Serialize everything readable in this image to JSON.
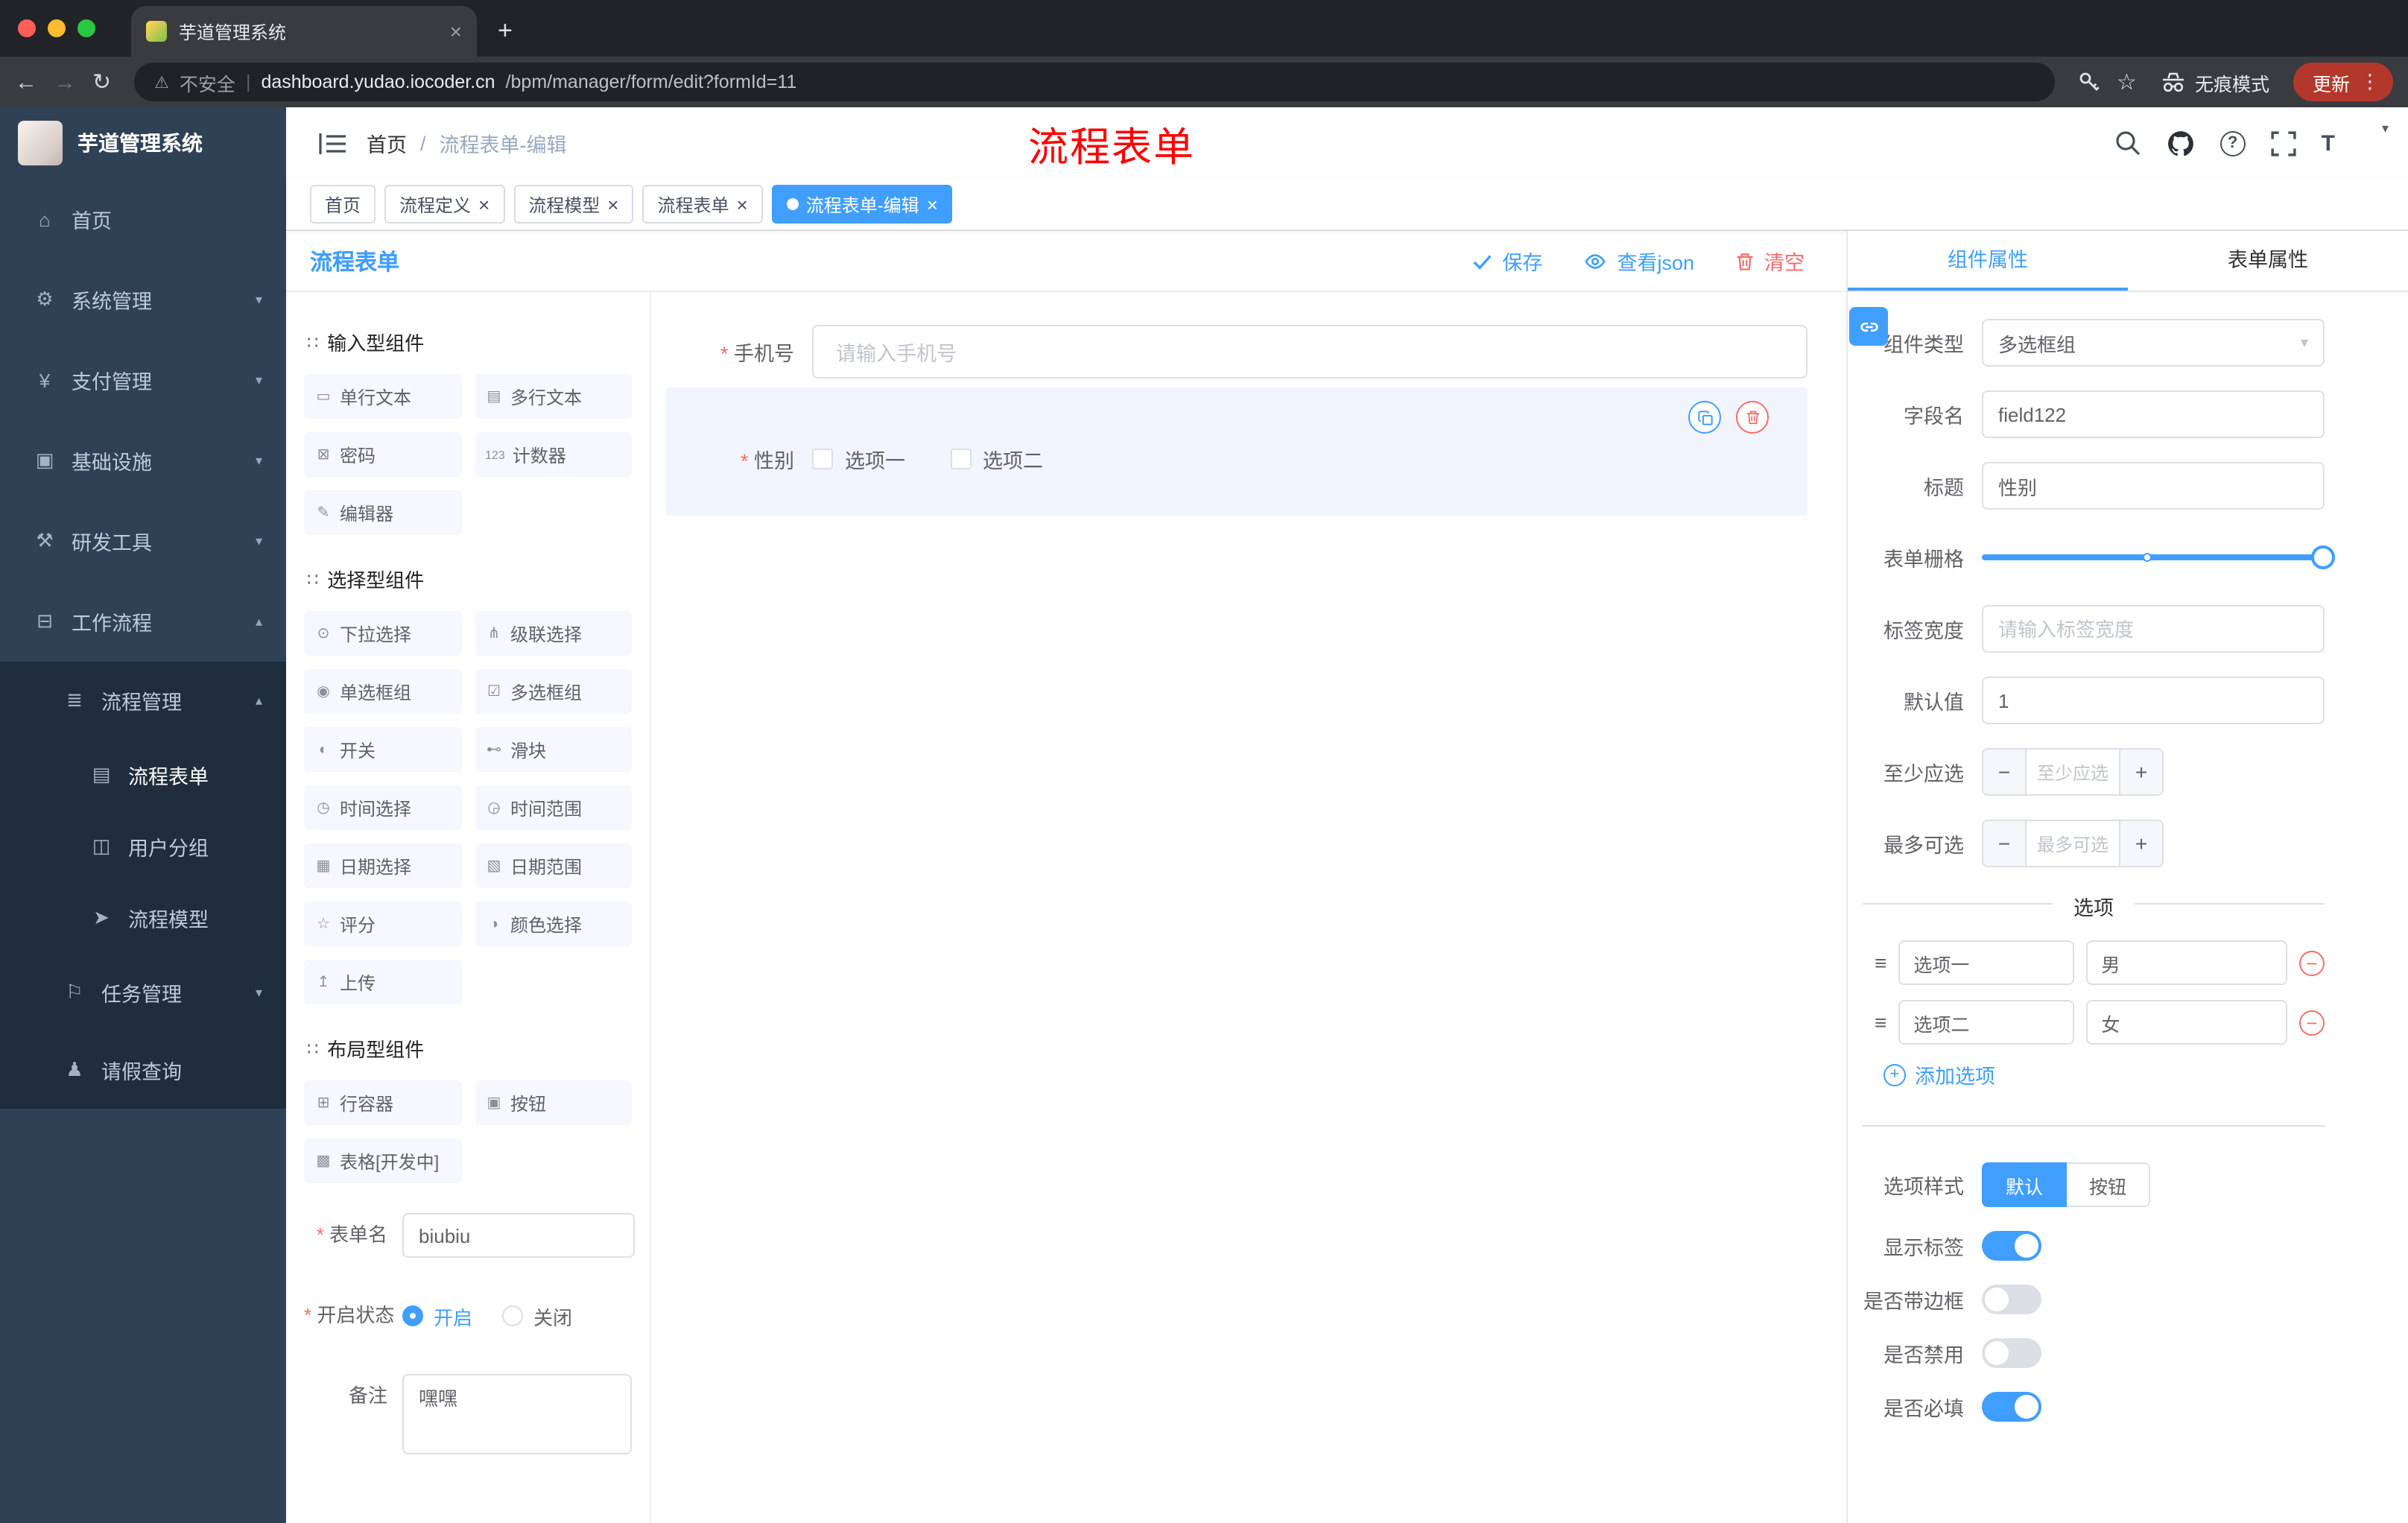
{
  "browser": {
    "tab_title": "芋道管理系统",
    "security_label": "不安全",
    "url_sep": "|",
    "url_domain": "dashboard.yudao.iocoder.cn",
    "url_path": "/bpm/manager/form/edit?formId=11",
    "incognito_label": "无痕模式",
    "update_label": "更新"
  },
  "header": {
    "breadcrumb_home": "首页",
    "breadcrumb_sep": "/",
    "breadcrumb_current": "流程表单-编辑",
    "annotation": "流程表单"
  },
  "tags": [
    {
      "label": "首页"
    },
    {
      "label": "流程定义",
      "close": "×"
    },
    {
      "label": "流程模型",
      "close": "×"
    },
    {
      "label": "流程表单",
      "close": "×"
    },
    {
      "label": "流程表单-编辑",
      "close": "×"
    }
  ],
  "sidebar": {
    "logo_text": "芋道管理系统",
    "items": [
      {
        "icon": "⌂",
        "label": "首页"
      },
      {
        "icon": "⚙",
        "label": "系统管理",
        "chevron": "▾"
      },
      {
        "icon": "¥",
        "label": "支付管理",
        "chevron": "▾"
      },
      {
        "icon": "▣",
        "label": "基础设施",
        "chevron": "▾"
      },
      {
        "icon": "⚒",
        "label": "研发工具",
        "chevron": "▾"
      },
      {
        "icon": "⊟",
        "label": "工作流程",
        "chevron": "▴"
      },
      {
        "icon": "≣",
        "label": "流程管理",
        "chevron": "▴"
      },
      {
        "icon": "▤",
        "label": "流程表单"
      },
      {
        "icon": "◫",
        "label": "用户分组"
      },
      {
        "icon": "➤",
        "label": "流程模型"
      },
      {
        "icon": "⚐",
        "label": "任务管理",
        "chevron": "▾"
      },
      {
        "icon": "♟",
        "label": "请假查询"
      }
    ]
  },
  "designer": {
    "title": "流程表单",
    "save": "保存",
    "view_json": "查看json",
    "clear": "清空",
    "groups": [
      {
        "icon": "∷",
        "title": "输入型组件",
        "items": [
          {
            "icon": "▭",
            "label": "单行文本"
          },
          {
            "icon": "▤",
            "label": "多行文本"
          },
          {
            "icon": "⊠",
            "label": "密码"
          },
          {
            "icon": "123",
            "label": "计数器"
          },
          {
            "icon": "✎",
            "label": "编辑器"
          }
        ]
      },
      {
        "icon": "∷",
        "title": "选择型组件",
        "items": [
          {
            "icon": "⊙",
            "label": "下拉选择"
          },
          {
            "icon": "⋔",
            "label": "级联选择"
          },
          {
            "icon": "◉",
            "label": "单选框组"
          },
          {
            "icon": "☑",
            "label": "多选框组"
          },
          {
            "icon": "◐",
            "label": "开关"
          },
          {
            "icon": "⊷",
            "label": "滑块"
          },
          {
            "icon": "◷",
            "label": "时间选择"
          },
          {
            "icon": "◶",
            "label": "时间范围"
          },
          {
            "icon": "▦",
            "label": "日期选择"
          },
          {
            "icon": "▧",
            "label": "日期范围"
          },
          {
            "icon": "☆",
            "label": "评分"
          },
          {
            "icon": "◑",
            "label": "颜色选择"
          },
          {
            "icon": "↥",
            "label": "上传"
          }
        ]
      },
      {
        "icon": "∷",
        "title": "布局型组件",
        "items": [
          {
            "icon": "⊞",
            "label": "行容器"
          },
          {
            "icon": "▣",
            "label": "按钮"
          },
          {
            "icon": "▩",
            "label": "表格[开发中]"
          }
        ]
      }
    ],
    "meta": {
      "form_name_label": "表单名",
      "form_name_value": "biubiu",
      "status_label": "开启状态",
      "status_on": "开启",
      "status_off": "关闭",
      "remark_label": "备注",
      "remark_value": "嘿嘿"
    },
    "canvas": {
      "phone_label": "手机号",
      "phone_placeholder": "请输入手机号",
      "gender_label": "性别",
      "gender_option1": "选项一",
      "gender_option2": "选项二"
    }
  },
  "props": {
    "tab_component": "组件属性",
    "tab_form": "表单属性",
    "component_type_label": "组件类型",
    "component_type_value": "多选框组",
    "field_name_label": "字段名",
    "field_name_value": "field122",
    "title_label": "标题",
    "title_value": "性别",
    "grid_label": "表单栅格",
    "label_width_label": "标签宽度",
    "label_width_placeholder": "请输入标签宽度",
    "default_label": "默认值",
    "default_value": "1",
    "min_label": "至少应选",
    "min_placeholder": "至少应选",
    "max_label": "最多可选",
    "max_placeholder": "最多可选",
    "options_title": "选项",
    "options": [
      {
        "label": "选项一",
        "value": "男"
      },
      {
        "label": "选项二",
        "value": "女"
      }
    ],
    "add_option": "添加选项",
    "option_style_label": "选项样式",
    "style_default": "默认",
    "style_button": "按钮",
    "toggle_show_label": "显示标签",
    "toggle_border_label": "是否带边框",
    "toggle_disabled_label": "是否禁用",
    "toggle_required_label": "是否必填"
  },
  "colors": {
    "primary": "#409eff",
    "danger": "#f56c6c",
    "sidebar_bg": "#304156",
    "submenu_bg": "#1f2d3d",
    "tag_active": "#409eff",
    "annotation_red": "#ff0000"
  }
}
